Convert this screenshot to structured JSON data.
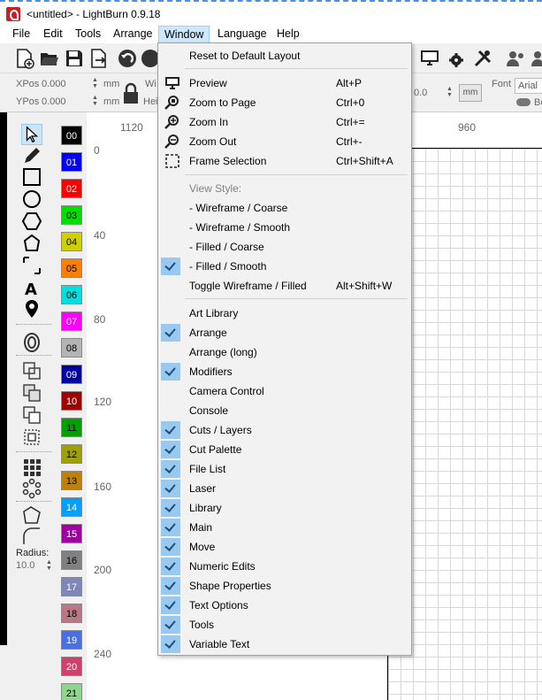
{
  "window": {
    "title": "<untitled> - LightBurn 0.9.18"
  },
  "menubar": [
    "File",
    "Edit",
    "Tools",
    "Arrange",
    "Window",
    "Language",
    "Help"
  ],
  "numeric_edits": {
    "xpos_label": "XPos",
    "xpos_value": "0.000",
    "ypos_label": "YPos",
    "ypos_value": "0.000",
    "unit": "mm",
    "w_label": "Wi",
    "h_label": "Hei",
    "right_value": "0.0",
    "right_unit": "mm",
    "font_label": "Font",
    "font_value": "Arial",
    "bold_label": "Bo"
  },
  "tools": {
    "radius_label": "Radius:",
    "radius_value": "10.0"
  },
  "palette": [
    {
      "label": "00",
      "color": "#000000",
      "text": "#ffffff"
    },
    {
      "label": "01",
      "color": "#0000ff",
      "text": "#ffffff"
    },
    {
      "label": "02",
      "color": "#ff0000",
      "text": "#ffffff"
    },
    {
      "label": "03",
      "color": "#00e000",
      "text": "#000000"
    },
    {
      "label": "04",
      "color": "#d0d000",
      "text": "#000000"
    },
    {
      "label": "05",
      "color": "#ff8000",
      "text": "#000000"
    },
    {
      "label": "06",
      "color": "#00e0e0",
      "text": "#000000"
    },
    {
      "label": "07",
      "color": "#ff00ff",
      "text": "#ffffff"
    },
    {
      "label": "08",
      "color": "#b4b4b4",
      "text": "#000000"
    },
    {
      "label": "09",
      "color": "#0000a0",
      "text": "#ffffff"
    },
    {
      "label": "10",
      "color": "#a00000",
      "text": "#ffffff"
    },
    {
      "label": "11",
      "color": "#00a000",
      "text": "#000000"
    },
    {
      "label": "12",
      "color": "#a0a000",
      "text": "#000000"
    },
    {
      "label": "13",
      "color": "#c08000",
      "text": "#000000"
    },
    {
      "label": "14",
      "color": "#00a0ff",
      "text": "#ffffff"
    },
    {
      "label": "15",
      "color": "#a000a0",
      "text": "#ffffff"
    },
    {
      "label": "16",
      "color": "#808080",
      "text": "#000000"
    },
    {
      "label": "17",
      "color": "#7d87b9",
      "text": "#ffffff"
    },
    {
      "label": "18",
      "color": "#bb7784",
      "text": "#000000"
    },
    {
      "label": "19",
      "color": "#4a6fe3",
      "text": "#ffffff"
    },
    {
      "label": "20",
      "color": "#d33f6a",
      "text": "#ffffff"
    },
    {
      "label": "21",
      "color": "#8cd78c",
      "text": "#000000"
    }
  ],
  "rulers": {
    "top": [
      "1120",
      "960"
    ],
    "left": [
      "0",
      "40",
      "80",
      "120",
      "160",
      "200",
      "240"
    ]
  },
  "window_menu": {
    "reset": "Reset to Default Layout",
    "view_items": [
      {
        "label": "Preview",
        "shortcut": "Alt+P",
        "icon": "monitor-icon"
      },
      {
        "label": "Zoom to Page",
        "shortcut": "Ctrl+0",
        "icon": "zoom-page-icon"
      },
      {
        "label": "Zoom In",
        "shortcut": "Ctrl+=",
        "icon": "zoom-in-icon"
      },
      {
        "label": "Zoom Out",
        "shortcut": "Ctrl+-",
        "icon": "zoom-out-icon"
      },
      {
        "label": "Frame Selection",
        "shortcut": "Ctrl+Shift+A",
        "icon": "frame-selection-icon"
      }
    ],
    "view_style_header": "View Style:",
    "styles": [
      {
        "label": "-  Wireframe / Coarse",
        "checked": false
      },
      {
        "label": "-  Wireframe / Smooth",
        "checked": false
      },
      {
        "label": "-  Filled / Coarse",
        "checked": false
      },
      {
        "label": "-  Filled / Smooth",
        "checked": true
      }
    ],
    "toggle": {
      "label": "Toggle Wireframe / Filled",
      "shortcut": "Alt+Shift+W"
    },
    "windows": [
      {
        "label": "Art Library",
        "checked": false
      },
      {
        "label": "Arrange",
        "checked": true
      },
      {
        "label": "Arrange (long)",
        "checked": false
      },
      {
        "label": "Modifiers",
        "checked": true
      },
      {
        "label": "Camera Control",
        "checked": false
      },
      {
        "label": "Console",
        "checked": false
      },
      {
        "label": "Cuts / Layers",
        "checked": true
      },
      {
        "label": "Cut Palette",
        "checked": true
      },
      {
        "label": "File List",
        "checked": true
      },
      {
        "label": "Laser",
        "checked": true
      },
      {
        "label": "Library",
        "checked": true
      },
      {
        "label": "Main",
        "checked": true
      },
      {
        "label": "Move",
        "checked": true
      },
      {
        "label": "Numeric Edits",
        "checked": true
      },
      {
        "label": "Shape Properties",
        "checked": true
      },
      {
        "label": "Text Options",
        "checked": true
      },
      {
        "label": "Tools",
        "checked": true
      },
      {
        "label": "Variable Text",
        "checked": true
      }
    ]
  }
}
